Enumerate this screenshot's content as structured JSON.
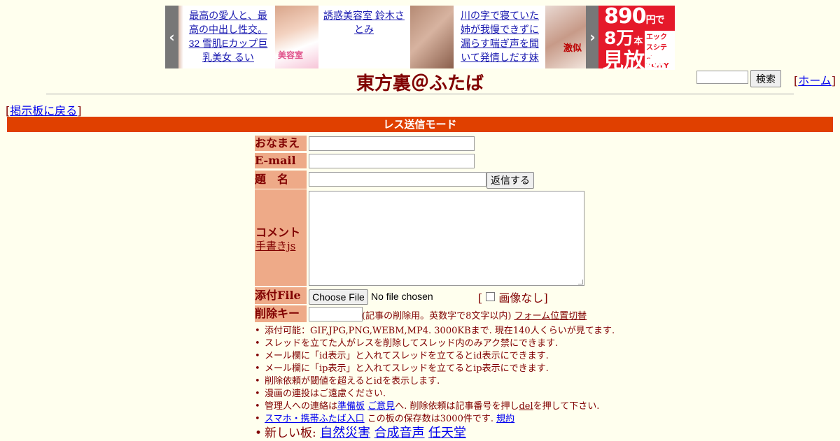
{
  "ads": {
    "items": [
      {
        "text": "最高の愛人と、最高の中出し性交。32 雪肌Eカップ巨乳美女 るい"
      },
      {
        "text": "誘惑美容室 鈴木さとみ"
      },
      {
        "text": "川の字で寝ていた姉が我慢できずに漏らす喘ぎ声を聞いて発情しだす妹"
      }
    ],
    "banner": {
      "price": "890",
      "price_unit": "円で",
      "count": "8万",
      "count_unit": "本",
      "brand": "エックスシティ XCITY",
      "plan": "見放題"
    }
  },
  "header": {
    "title": "東方裏＠ふたば",
    "search_button": "検索",
    "home_link": "ホーム",
    "back_link": "掲示板に戻る"
  },
  "mode_bar": "レス送信モード",
  "form": {
    "name_label": "おなまえ",
    "email_label": "E-mail",
    "subject_label": "題　名",
    "reply_button": "返信する",
    "comment_label": "コメント",
    "handwrite_link": "手書きjs",
    "file_label": "添付File",
    "choose_file_button": "Choose File",
    "no_file_text": "No file chosen",
    "no_image_label": "画像なし",
    "delete_key_label": "削除キー",
    "delete_key_note": "(記事の削除用。英数字で8文字以内)",
    "form_position_link": "フォーム位置切替"
  },
  "notes": {
    "n1": "添付可能：GIF,JPG,PNG,WEBM,MP4. 3000KBまで. 現在140人くらいが見てます.",
    "n2": "スレッドを立てた人がレスを削除してスレッド内のみアク禁にできます.",
    "n3": "メール欄に「id表示」と入れてスレッドを立てるとid表示にできます.",
    "n4": "メール欄に「ip表示」と入れてスレッドを立てるとip表示にできます.",
    "n5": "削除依頼が閾値を超えるとidを表示します.",
    "n6": "漫画の連投はご遠慮ください.",
    "n7_prefix": "管理人への連絡は",
    "n7_link1": "準備板",
    "n7_link2": "ご意見",
    "n7_mid": "へ. 削除依頼は記事番号を押し",
    "n7_del": "del",
    "n7_suffix": "を押して下さい.",
    "n8_link": "スマホ・携帯ふたば入口",
    "n8_text": "この板の保存数は3000件です.",
    "n8_rules": "規約",
    "n9_prefix": "新しい板:",
    "n9_boards": [
      "自然災害",
      "合成音声",
      "任天堂"
    ]
  }
}
